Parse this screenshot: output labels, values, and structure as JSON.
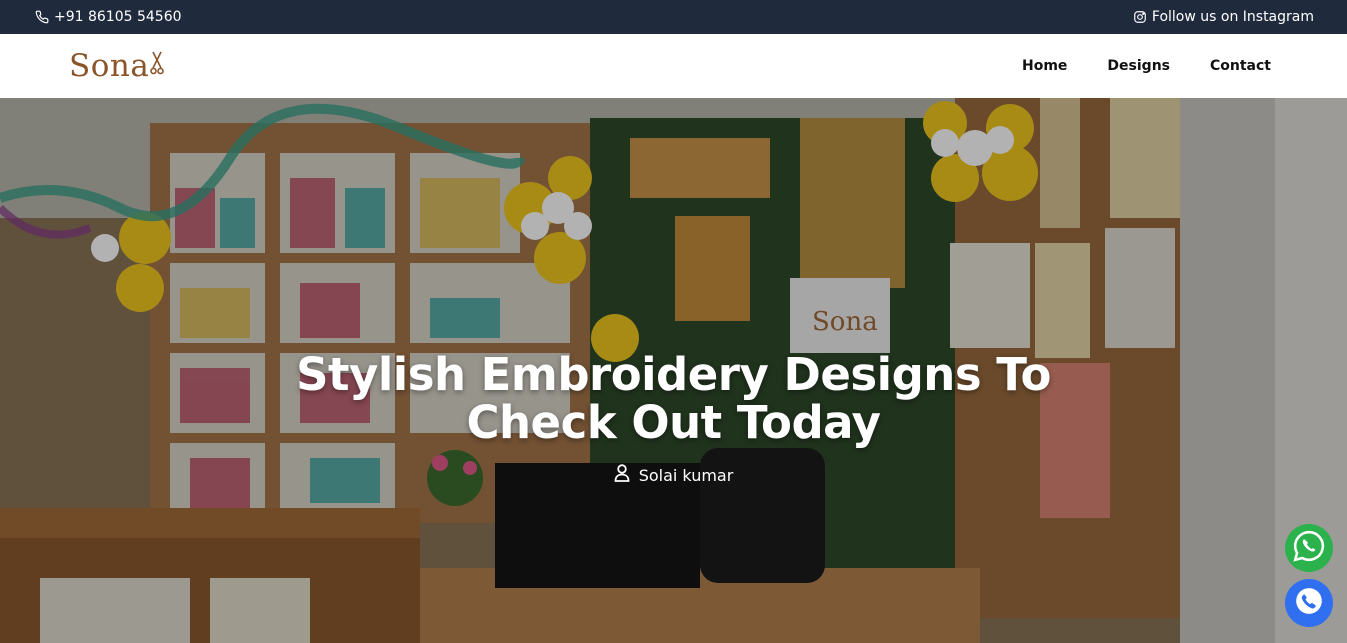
{
  "topbar": {
    "phone": "+91 86105 54560",
    "phone_icon": "phone-icon",
    "social": "Follow us on Instagram",
    "social_icon": "instagram-icon"
  },
  "brand": {
    "logo_text": "Sona",
    "logo_mark": "scissors-icon"
  },
  "nav": {
    "items": [
      {
        "label": "Home"
      },
      {
        "label": "Designs"
      },
      {
        "label": "Contact"
      }
    ]
  },
  "hero": {
    "title_line1": "Stylish Embroidery Designs To",
    "title_line2": "Check Out Today",
    "author": "Solai kumar",
    "author_icon": "user-icon",
    "image_logo_text": "Sona"
  },
  "floating": {
    "whatsapp_icon": "whatsapp-icon",
    "phone_icon": "phone-call-icon"
  },
  "colors": {
    "topbar_bg": "#1f2a3c",
    "brand": "#8a5528",
    "whatsapp": "#2bb24c",
    "call": "#2f6ff0"
  }
}
